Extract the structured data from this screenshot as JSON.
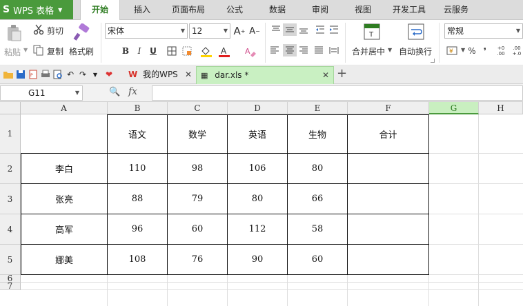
{
  "app": {
    "name": "WPS 表格"
  },
  "menu_tabs": [
    "开始",
    "插入",
    "页面布局",
    "公式",
    "数据",
    "审阅",
    "视图",
    "开发工具",
    "云服务"
  ],
  "ribbon": {
    "paste": "粘贴",
    "cut": "剪切",
    "copy": "复制",
    "format_painter": "格式刷",
    "font_name": "宋体",
    "font_size": "12",
    "merge_center": "合并居中",
    "wrap_text": "自动换行",
    "number_format": "常规",
    "percent": "%",
    "comma": "❜",
    "dec_inc": ".00 +.0",
    "dec_dec": ".00 →.0"
  },
  "doc_tabs": {
    "home": "我的WPS",
    "file": "dar.xls *",
    "new": "+"
  },
  "formula_bar": {
    "name_box": "G11",
    "fx": "fx"
  },
  "grid": {
    "columns": [
      "A",
      "B",
      "C",
      "D",
      "E",
      "F",
      "G",
      "H"
    ],
    "rows": [
      "1",
      "2",
      "3",
      "4",
      "5",
      "6",
      "7"
    ],
    "header_row": [
      "",
      "语文",
      "数学",
      "英语",
      "生物",
      "合计"
    ],
    "data": [
      [
        "李白",
        "110",
        "98",
        "106",
        "80",
        ""
      ],
      [
        "张亮",
        "88",
        "79",
        "80",
        "66",
        ""
      ],
      [
        "高军",
        "96",
        "60",
        "112",
        "58",
        ""
      ],
      [
        "娜美",
        "108",
        "76",
        "90",
        "60",
        ""
      ]
    ],
    "selected_column": "G"
  },
  "colors": {
    "brand_green": "#4a9a3c",
    "active_tab_text": "#2f7d22",
    "doc_tab_bg": "#c9f0c2"
  }
}
